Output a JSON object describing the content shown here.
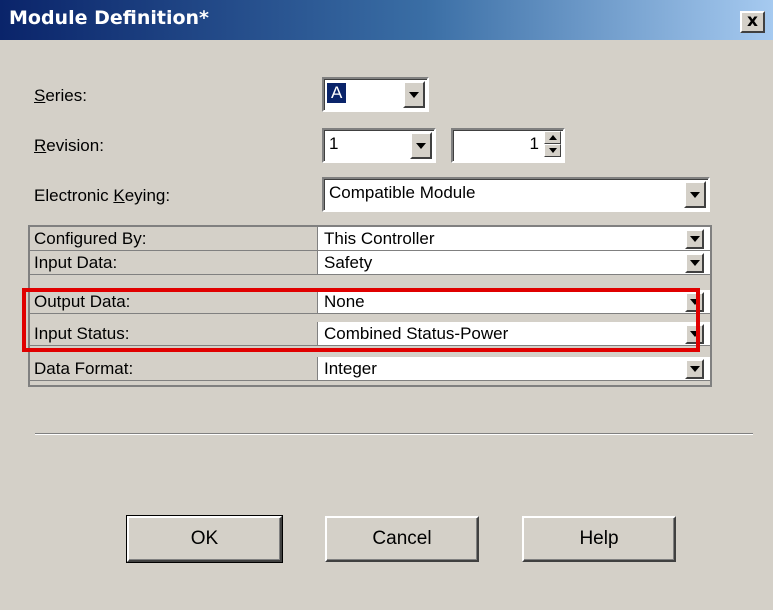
{
  "window": {
    "title": "Module Definition*",
    "close_glyph": "x"
  },
  "fields": {
    "series": {
      "label_prefix": "",
      "label_mnemonic": "S",
      "label_rest": "eries:",
      "value": "A"
    },
    "revision": {
      "label_mnemonic": "R",
      "label_rest": "evision:",
      "major": "1",
      "minor": "1"
    },
    "keying": {
      "label_prefix": "Electronic ",
      "label_mnemonic": "K",
      "label_rest": "eying:",
      "value": "Compatible Module"
    }
  },
  "grid": {
    "rows": [
      {
        "key": "Configured By:",
        "value": "This Controller"
      },
      {
        "key": "Input Data:",
        "value": "Safety"
      },
      {
        "key": "Output Data:",
        "value": "None"
      },
      {
        "key": "Input Status:",
        "value": "Combined Status-Power"
      },
      {
        "key": "Data Format:",
        "value": "Integer"
      }
    ]
  },
  "buttons": {
    "ok": "OK",
    "cancel": "Cancel",
    "help": "Help"
  },
  "colors": {
    "highlight": "#e00000",
    "title_bar": "#0a246a",
    "face": "#d4d0c8"
  }
}
